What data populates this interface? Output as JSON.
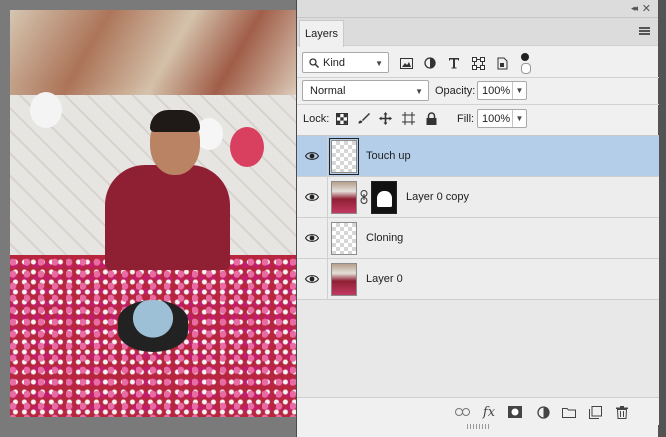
{
  "panel": {
    "title": "Layers",
    "window_controls": {
      "collapse": "◂◂",
      "close": "✕"
    }
  },
  "filter": {
    "kind_label": "Kind",
    "icons": [
      "image-filter-icon",
      "adjustment-filter-icon",
      "type-filter-icon",
      "shape-filter-icon",
      "smart-object-filter-icon"
    ]
  },
  "blend": {
    "mode": "Normal",
    "opacity_label": "Opacity:",
    "opacity": "100%"
  },
  "lock": {
    "label": "Lock:",
    "fill_label": "Fill:",
    "fill": "100%",
    "icons": [
      "lock-transparent-icon",
      "lock-pixels-icon",
      "lock-position-icon",
      "lock-artboard-icon",
      "lock-all-icon"
    ]
  },
  "layers": [
    {
      "name": "Touch up",
      "selected": true,
      "thumb": "transparent"
    },
    {
      "name": "Layer 0 copy",
      "selected": false,
      "thumb": "photo-with-mask"
    },
    {
      "name": "Cloning",
      "selected": false,
      "thumb": "transparent"
    },
    {
      "name": "Layer 0",
      "selected": false,
      "thumb": "photo"
    }
  ],
  "bottom_toolbar": {
    "icons": [
      "link-layers-icon",
      "fx-icon",
      "add-mask-icon",
      "adjustment-layer-icon",
      "new-group-icon",
      "new-layer-icon",
      "delete-layer-icon"
    ],
    "fx_label": "fx"
  },
  "colors": {
    "panel_bg": "#f0f0f0",
    "selected_layer": "#b4cde9",
    "workspace": "#535353"
  }
}
